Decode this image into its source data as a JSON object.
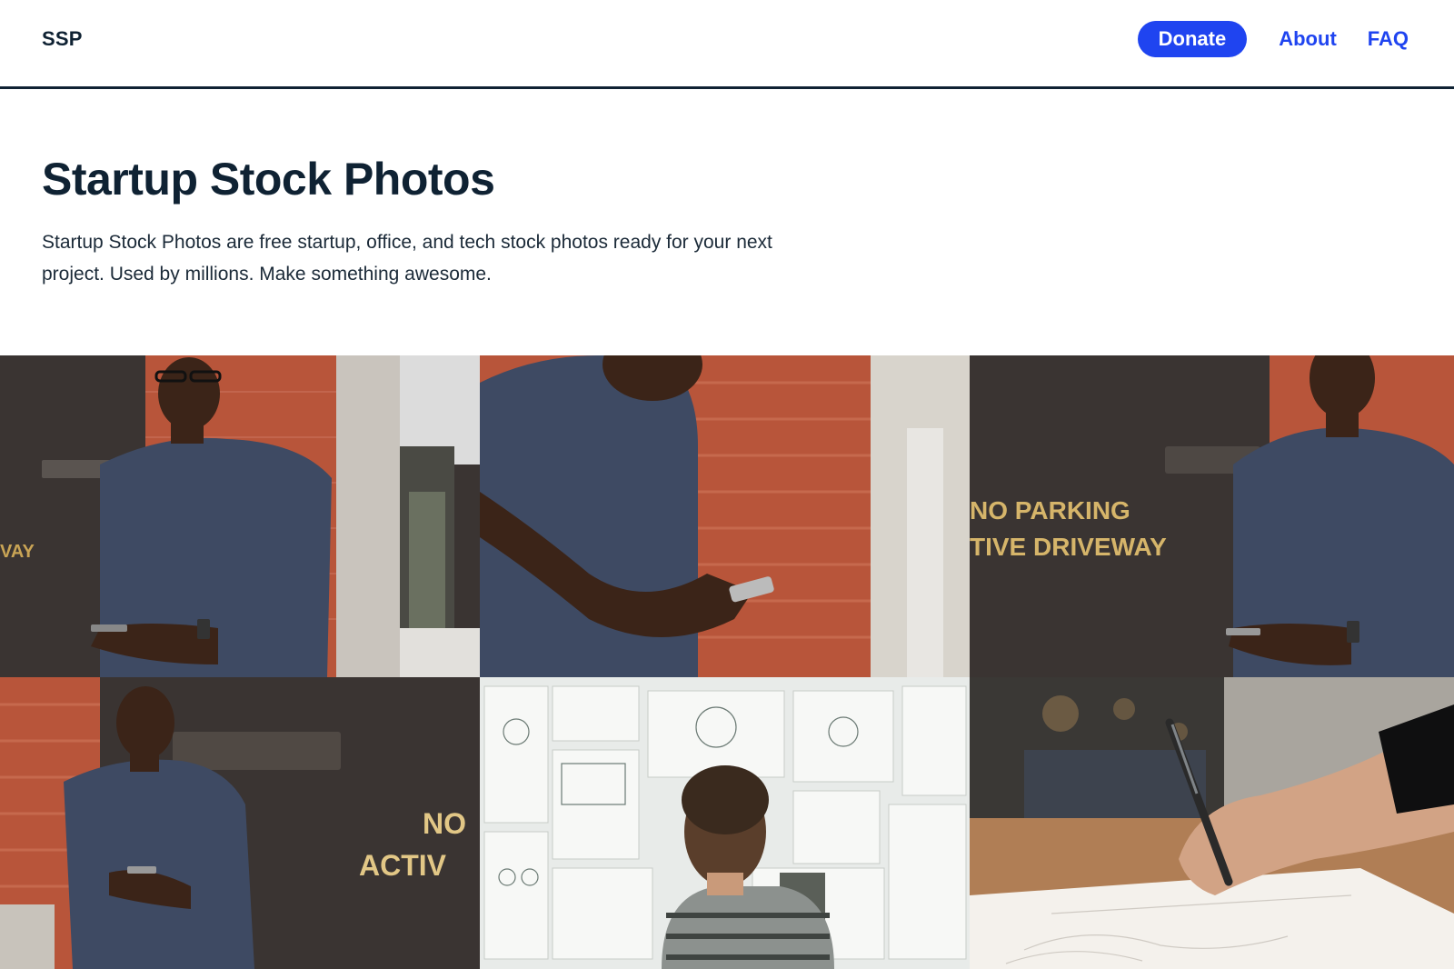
{
  "header": {
    "logo": "SSP",
    "nav": {
      "donate_label": "Donate",
      "about_label": "About",
      "faq_label": "FAQ"
    }
  },
  "hero": {
    "title": "Startup Stock Photos",
    "description": "Startup Stock Photos are free startup, office, and tech stock photos ready for your next project. Used by millions. Make something awesome."
  },
  "photos": [
    {
      "subject": "man-with-phone-by-brick-wall",
      "sign_text": "VAY"
    },
    {
      "subject": "man-texting-closeup",
      "sign_text": ""
    },
    {
      "subject": "man-by-no-parking-sign",
      "sign_text": "NO PARKING\nTIVE DRIVEWAY"
    },
    {
      "subject": "man-leaning-on-door",
      "sign_text": "NO\nACTIV"
    },
    {
      "subject": "man-facing-wall-of-sketches",
      "sign_text": ""
    },
    {
      "subject": "hand-writing-on-paper",
      "sign_text": ""
    }
  ],
  "colors": {
    "accent": "#1f44f0",
    "text_dark": "#0f2233",
    "brick": "#b8553a",
    "door_dark": "#3a3432",
    "shirt": "#3e4a63"
  }
}
